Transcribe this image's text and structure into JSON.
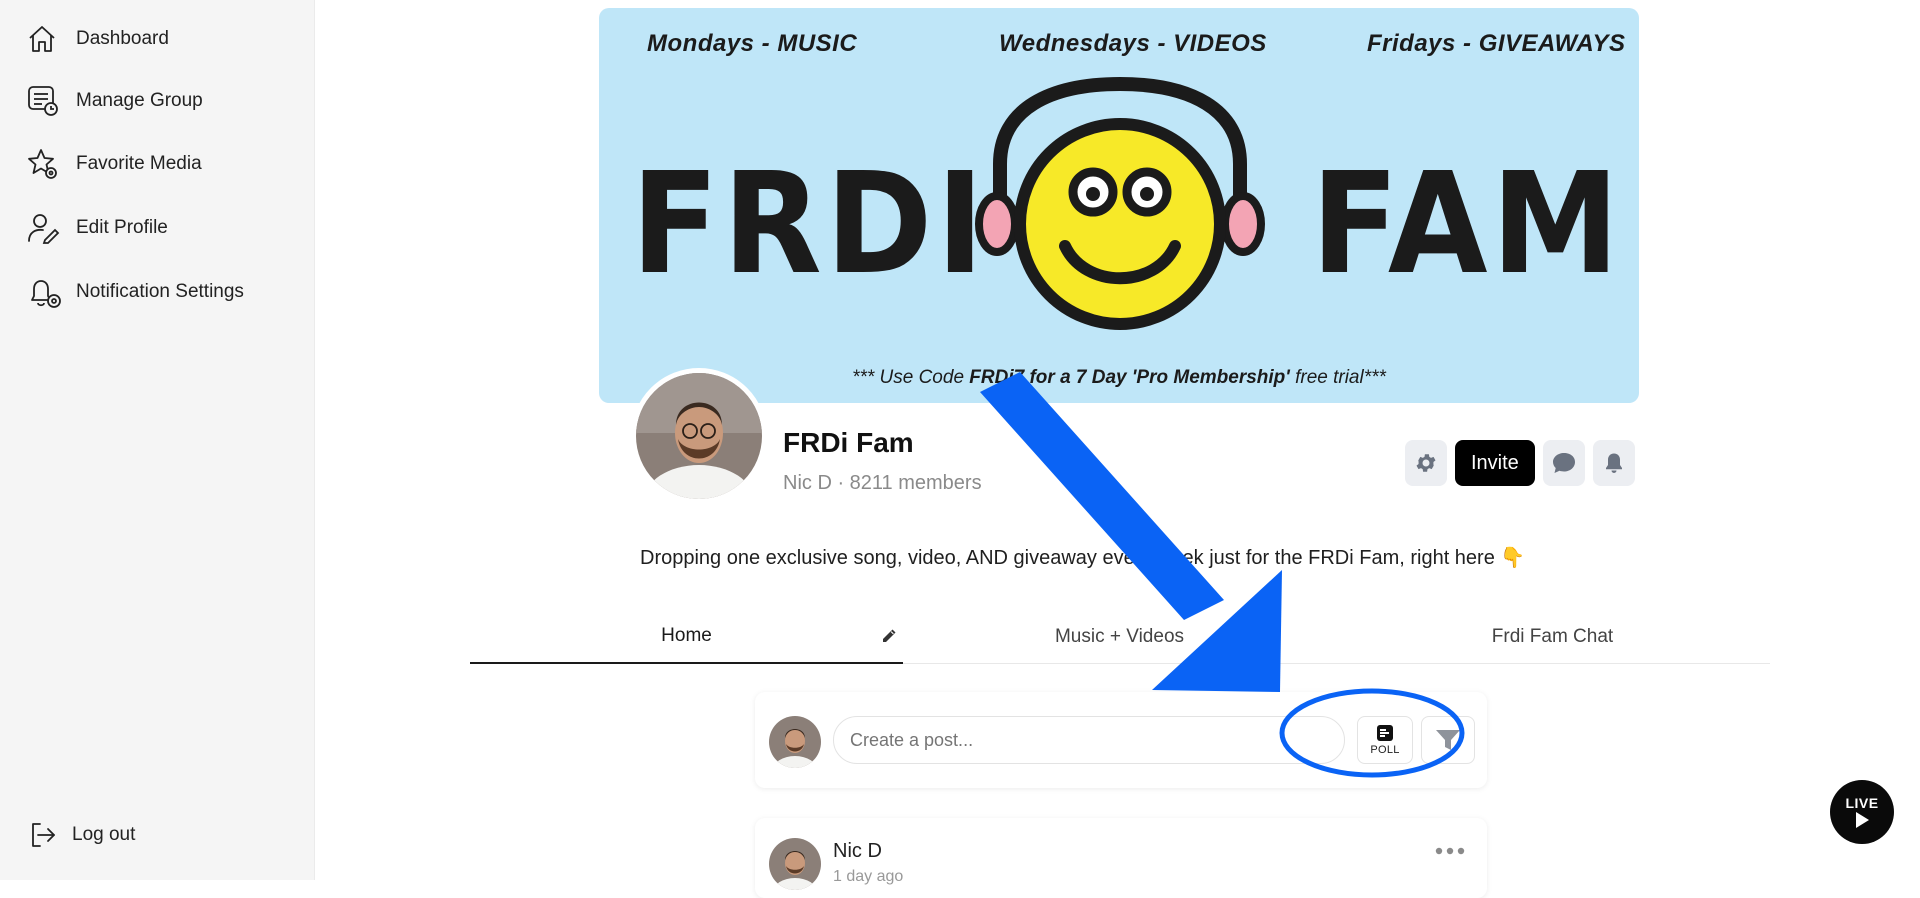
{
  "sidebar": {
    "items": [
      {
        "label": "Dashboard",
        "icon": "home-icon"
      },
      {
        "label": "Manage Group",
        "icon": "manage-group-icon"
      },
      {
        "label": "Favorite Media",
        "icon": "star-icon"
      },
      {
        "label": "Edit Profile",
        "icon": "user-edit-icon"
      },
      {
        "label": "Notification Settings",
        "icon": "bell-settings-icon"
      }
    ],
    "logout": {
      "label": "Log out",
      "icon": "logout-icon"
    }
  },
  "banner": {
    "schedule_left": "Mondays - MUSIC",
    "schedule_center": "Wednesdays - VIDEOS",
    "schedule_right": "Fridays - GIVEAWAYS",
    "word_left": "FRDI",
    "word_right": "FAM",
    "promo_prefix": "*** Use Code ",
    "promo_code": "FRDi7 for a 7 Day 'Pro Membership'",
    "promo_suffix": " free trial***",
    "background_color": "#bfe6f8"
  },
  "group": {
    "name": "FRDi Fam",
    "owner": "Nic D",
    "members": "· 8211 members",
    "description": "Dropping one exclusive song, video, AND giveaway every week just for the FRDi Fam, right here 👇"
  },
  "actions": {
    "settings_icon": "gear-icon",
    "invite_label": "Invite",
    "chat_icon": "chat-icon",
    "bell_icon": "bell-icon"
  },
  "tabs": [
    {
      "label": "Home",
      "active": true
    },
    {
      "label": "Music + Videos",
      "active": false
    },
    {
      "label": "Frdi Fam Chat",
      "active": false
    }
  ],
  "composer": {
    "placeholder": "Create a post...",
    "poll_label": "POLL"
  },
  "post": {
    "author": "Nic D",
    "time": "1 day ago"
  },
  "live_button": {
    "label": "LIVE"
  },
  "annotation": {
    "arrow_color": "#0a63f5",
    "circle_color": "#0a63f5"
  }
}
